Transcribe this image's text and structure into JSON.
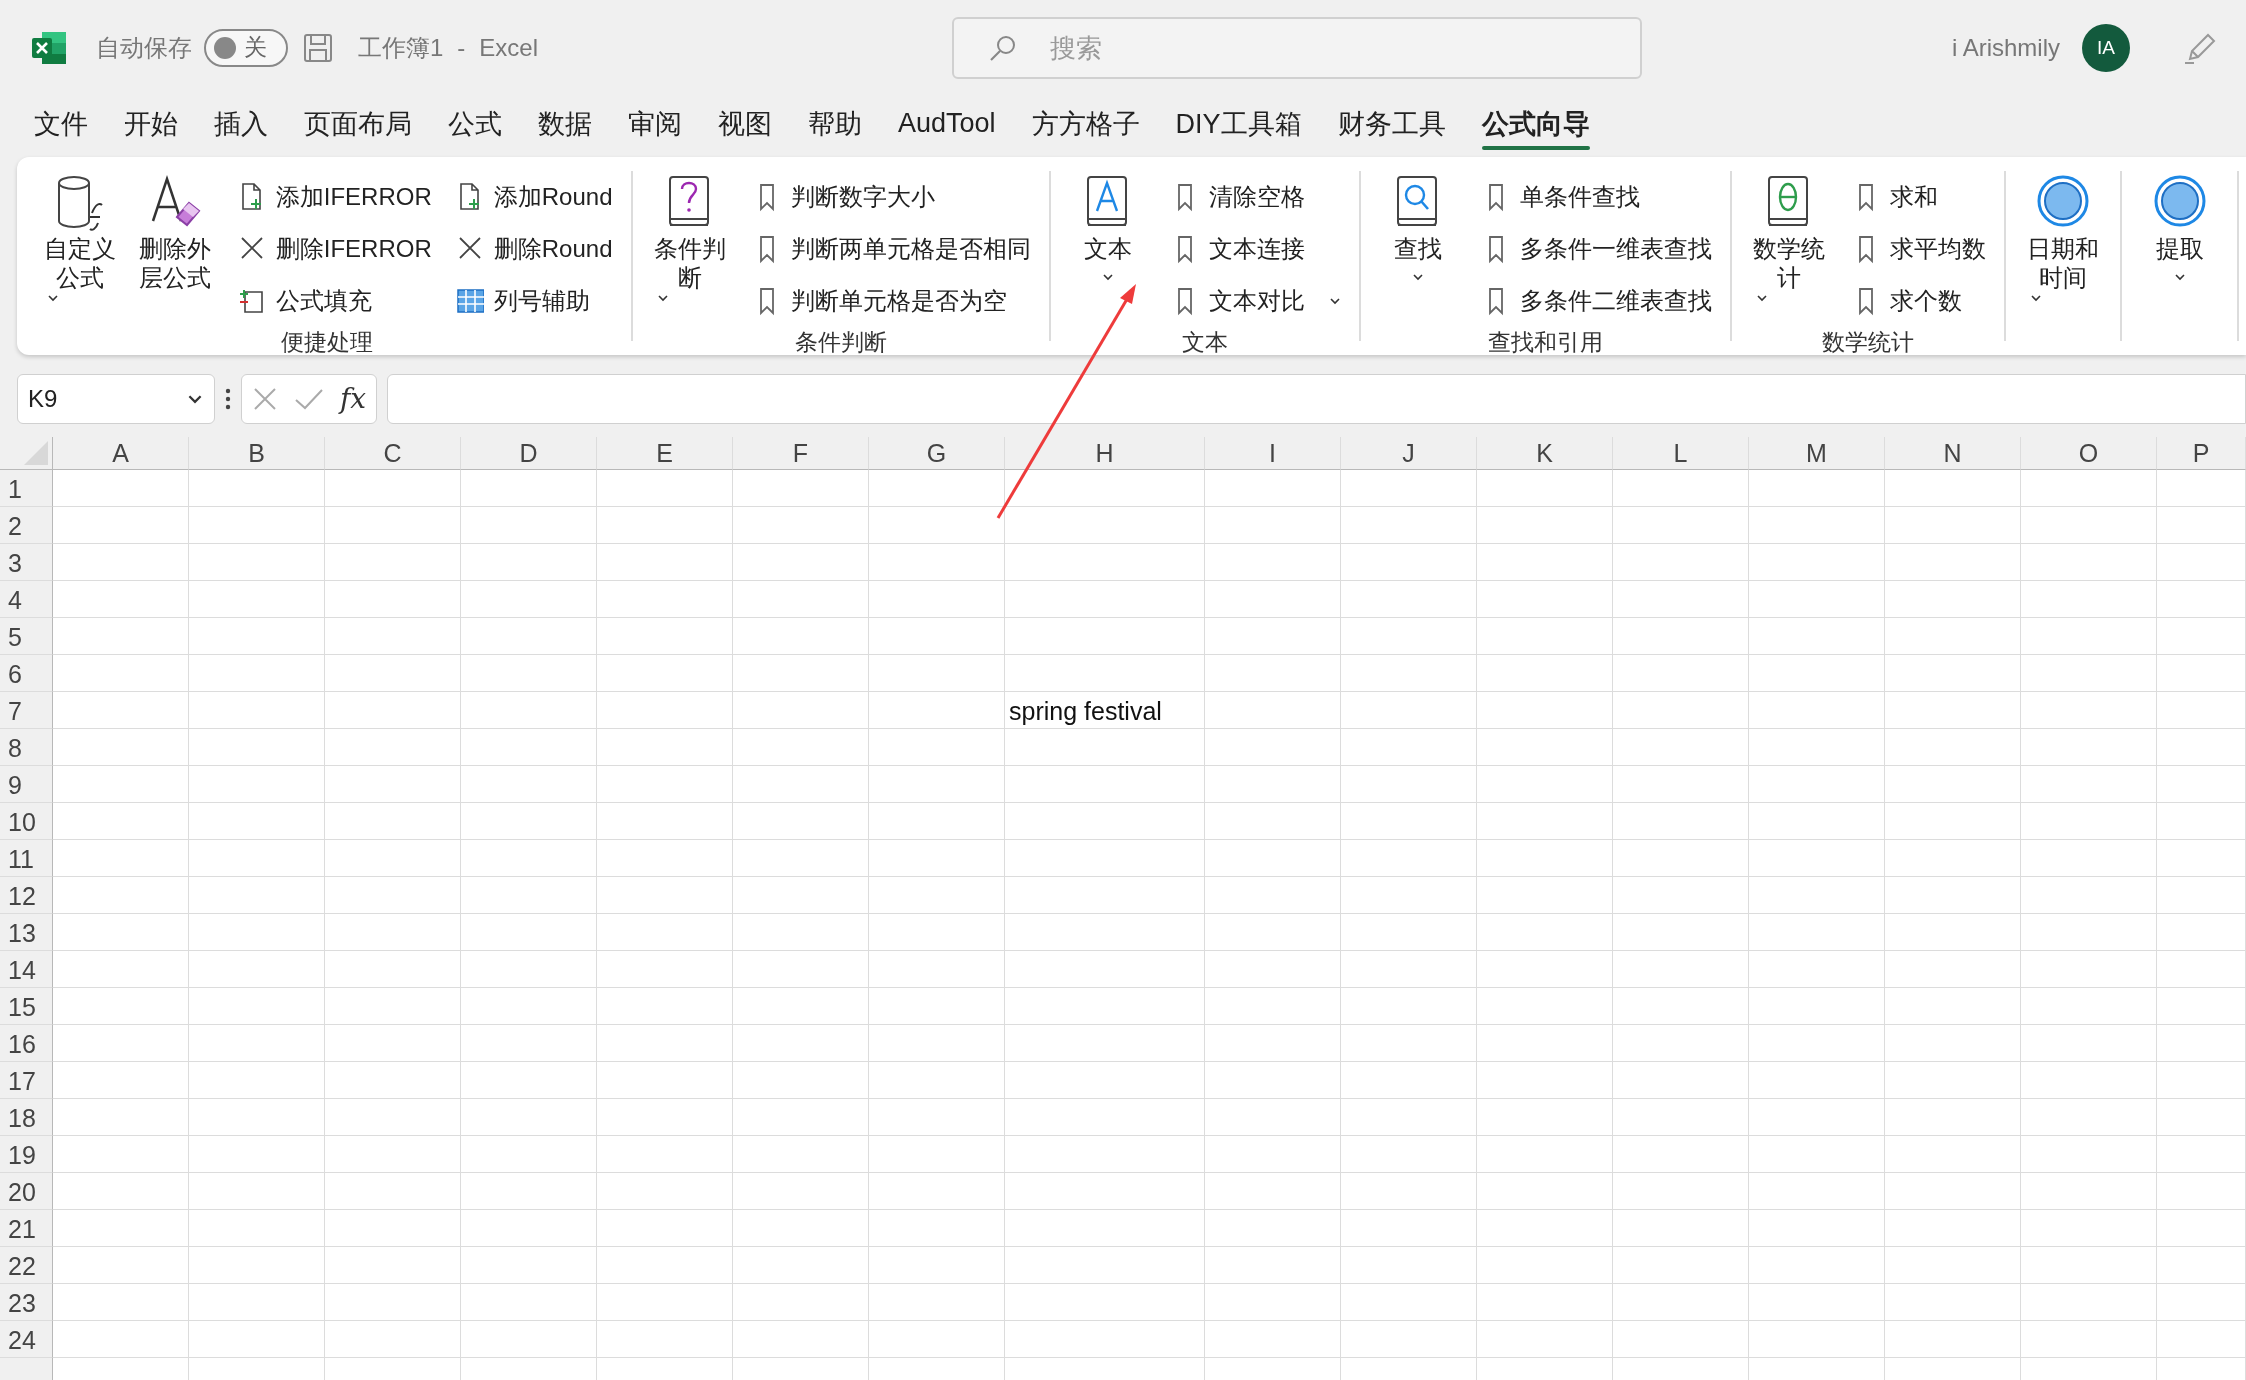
{
  "title_bar": {
    "autosave_label": "自动保存",
    "autosave": {
      "on": false,
      "label": "关"
    },
    "document_title": "工作簿1",
    "title_separator": "-",
    "app_name": "Excel",
    "search": {
      "placeholder": "搜索"
    },
    "user_name": "i Arishmily",
    "avatar_initials": "IA"
  },
  "menu_tabs": [
    {
      "label": "文件",
      "selected": false
    },
    {
      "label": "开始",
      "selected": false
    },
    {
      "label": "插入",
      "selected": false
    },
    {
      "label": "页面布局",
      "selected": false
    },
    {
      "label": "公式",
      "selected": false
    },
    {
      "label": "数据",
      "selected": false
    },
    {
      "label": "审阅",
      "selected": false
    },
    {
      "label": "视图",
      "selected": false
    },
    {
      "label": "帮助",
      "selected": false
    },
    {
      "label": "AudTool",
      "selected": false
    },
    {
      "label": "方方格子",
      "selected": false
    },
    {
      "label": "DIY工具箱",
      "selected": false
    },
    {
      "label": "财务工具",
      "selected": false
    },
    {
      "label": "公式向导",
      "selected": true
    }
  ],
  "ribbon": {
    "groups": [
      {
        "label": "便捷处理",
        "large_buttons": [
          {
            "label": "自定义公式",
            "dropdown": true
          },
          {
            "label": "删除外层公式",
            "dropdown": false
          }
        ],
        "small_columns": [
          [
            {
              "label": "添加IFERROR",
              "dropdown": false
            },
            {
              "label": "删除IFERROR",
              "dropdown": false
            },
            {
              "label": "公式填充",
              "dropdown": false
            }
          ],
          [
            {
              "label": "添加Round",
              "dropdown": false
            },
            {
              "label": "删除Round",
              "dropdown": false
            },
            {
              "label": "列号辅助",
              "dropdown": false
            }
          ]
        ]
      },
      {
        "label": "条件判断",
        "large_buttons": [
          {
            "label": "条件判断",
            "dropdown": true
          }
        ],
        "small_columns": [
          [
            {
              "label": "判断数字大小",
              "dropdown": false
            },
            {
              "label": "判断两单元格是否相同",
              "dropdown": false
            },
            {
              "label": "判断单元格是否为空",
              "dropdown": false
            }
          ]
        ]
      },
      {
        "label": "文本",
        "large_buttons": [
          {
            "label": "文本",
            "dropdown": true
          }
        ],
        "small_columns": [
          [
            {
              "label": "清除空格",
              "dropdown": false
            },
            {
              "label": "文本连接",
              "dropdown": false
            },
            {
              "label": "文本对比",
              "dropdown": true
            }
          ]
        ]
      },
      {
        "label": "查找和引用",
        "large_buttons": [
          {
            "label": "查找",
            "dropdown": true
          }
        ],
        "small_columns": [
          [
            {
              "label": "单条件查找",
              "dropdown": false
            },
            {
              "label": "多条件一维表查找",
              "dropdown": false
            },
            {
              "label": "多条件二维表查找",
              "dropdown": false
            }
          ]
        ]
      },
      {
        "label": "数学统计",
        "large_buttons": [
          {
            "label": "数学统计",
            "dropdown": true
          }
        ],
        "small_columns": [
          [
            {
              "label": "求和",
              "dropdown": false
            },
            {
              "label": "求平均数",
              "dropdown": false
            },
            {
              "label": "求个数",
              "dropdown": false
            }
          ]
        ]
      },
      {
        "large_buttons": [
          {
            "label": "日期和时间",
            "dropdown": true
          }
        ]
      },
      {
        "large_buttons": [
          {
            "label": "提取",
            "dropdown": true
          }
        ]
      }
    ]
  },
  "formula_bar": {
    "name_box": "K9",
    "insert_function_label": "fx"
  },
  "sheet": {
    "columns": [
      "A",
      "B",
      "C",
      "D",
      "E",
      "F",
      "G",
      "H",
      "I",
      "J",
      "K",
      "L",
      "M",
      "N",
      "O",
      "P"
    ],
    "rows": [
      {
        "number": "1"
      },
      {
        "number": "2"
      },
      {
        "number": "3"
      },
      {
        "number": "4"
      },
      {
        "number": "5"
      },
      {
        "number": "6"
      },
      {
        "number": "7",
        "cells": [
          null,
          null,
          null,
          null,
          null,
          null,
          null,
          "spring festival"
        ]
      },
      {
        "number": "8"
      },
      {
        "number": "9"
      },
      {
        "number": "10"
      },
      {
        "number": "11"
      },
      {
        "number": "12"
      },
      {
        "number": "13"
      },
      {
        "number": "14"
      },
      {
        "number": "15"
      },
      {
        "number": "16"
      },
      {
        "number": "17"
      },
      {
        "number": "18"
      },
      {
        "number": "19"
      },
      {
        "number": "20"
      },
      {
        "number": "21"
      },
      {
        "number": "22"
      },
      {
        "number": "23"
      },
      {
        "number": "24"
      }
    ]
  }
}
